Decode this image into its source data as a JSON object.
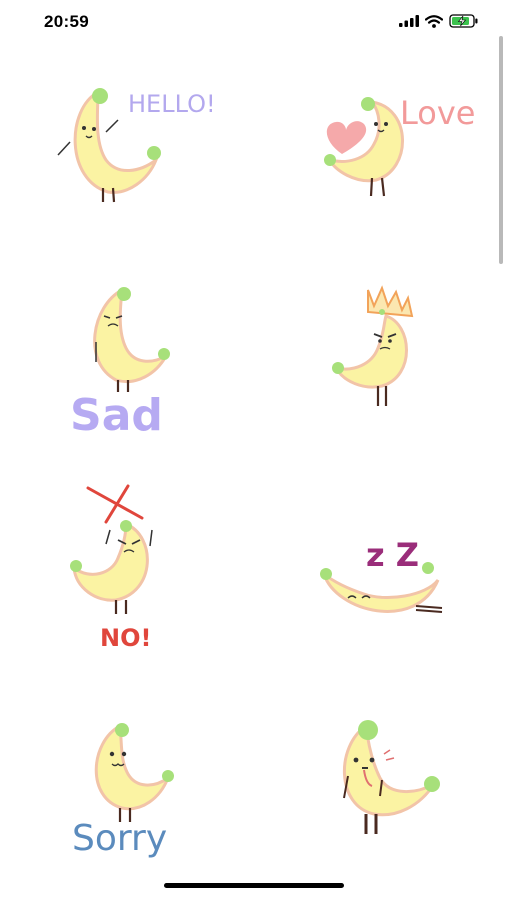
{
  "status_bar": {
    "time": "20:59",
    "icons": [
      "cellular-signal-icon",
      "wifi-icon",
      "battery-charging-icon"
    ]
  },
  "stickers": [
    {
      "id": "hello",
      "caption": "HELLO!",
      "caption_color": "#b3a8ee"
    },
    {
      "id": "love",
      "caption": "Love",
      "caption_color": "#f29a9a"
    },
    {
      "id": "sad",
      "caption": "Sad",
      "caption_color": "#b6aaf2"
    },
    {
      "id": "angry",
      "caption": "",
      "caption_color": "#f2a35a"
    },
    {
      "id": "no",
      "caption": "NO!",
      "caption_color": "#e0463c"
    },
    {
      "id": "sleep",
      "caption": "z Z",
      "caption_color": "#9a2d7a"
    },
    {
      "id": "sorry",
      "caption": "Sorry",
      "caption_color": "#5b8bbd"
    },
    {
      "id": "shy",
      "caption": "",
      "caption_color": "#e07070"
    }
  ],
  "colors": {
    "banana": "#fbf3a3",
    "banana_shadow": "#f1c6b0",
    "banana_tip": "#a7e07a",
    "legs": "#4a2a20"
  }
}
